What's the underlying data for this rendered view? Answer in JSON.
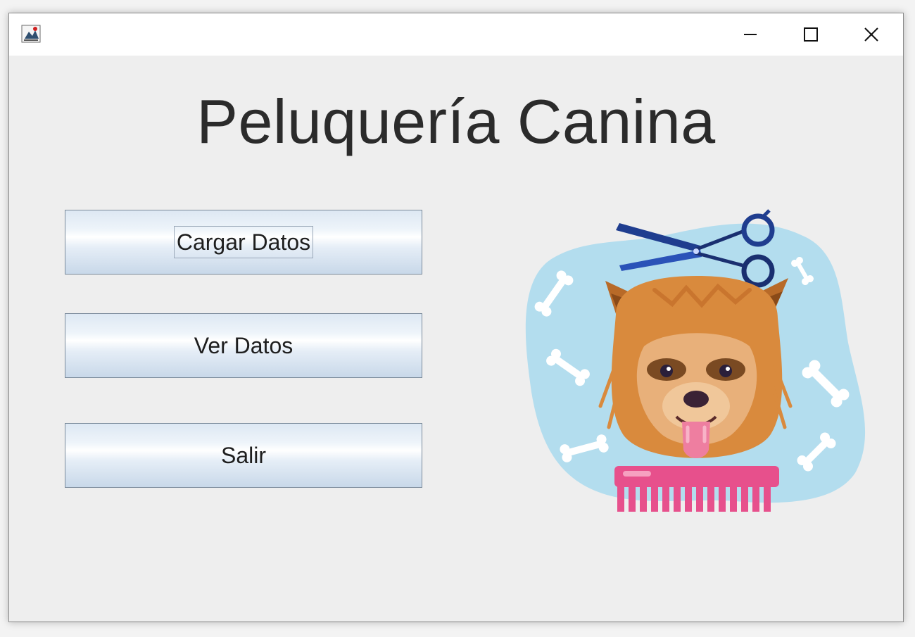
{
  "window": {
    "app_icon": "java-duke-icon",
    "controls": {
      "minimize_icon": "minimize-icon",
      "maximize_icon": "maximize-icon",
      "close_icon": "close-icon"
    }
  },
  "main": {
    "title": "Peluquería Canina",
    "buttons": {
      "cargar": "Cargar Datos",
      "ver": "Ver Datos",
      "salir": "Salir"
    },
    "illustration": "dog-grooming-illustration"
  },
  "colors": {
    "background": "#eeeeee",
    "title_text": "#2b2b2b",
    "blob": "#b3ddee",
    "dog_fur": "#d98a3d",
    "comb": "#e7508c",
    "scissors": "#1f3d8f"
  }
}
